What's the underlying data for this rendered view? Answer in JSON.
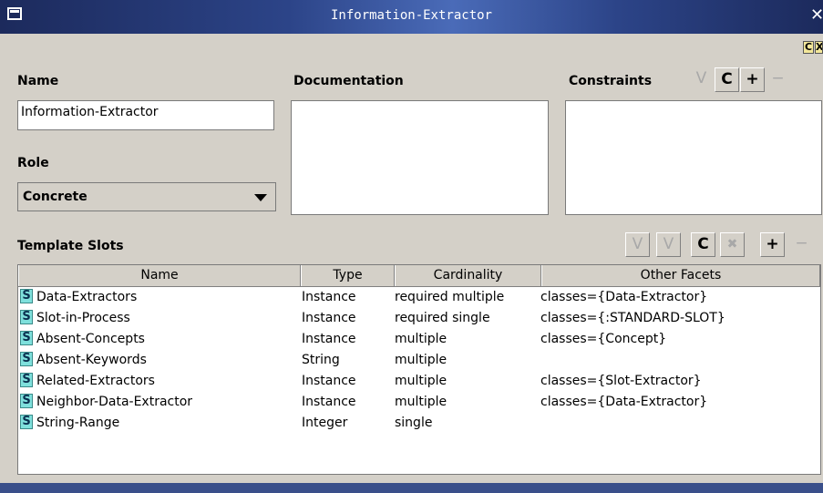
{
  "window": {
    "title": "Information-Extractor",
    "close_glyph": "✕"
  },
  "strip": {
    "c_label": "C",
    "x_label": "X"
  },
  "name_section": {
    "label": "Name",
    "value": "Information-Extractor"
  },
  "role_section": {
    "label": "Role",
    "value": "Concrete"
  },
  "documentation": {
    "label": "Documentation"
  },
  "constraints": {
    "label": "Constraints",
    "v_label": "V",
    "c_label": "C",
    "add_label": "+",
    "remove_label": "−"
  },
  "template_slots": {
    "label": "Template Slots",
    "buttons": {
      "v1": "V",
      "v2": "V",
      "c": "C",
      "x": "✖",
      "add": "+",
      "remove": "−"
    },
    "columns": [
      "Name",
      "Type",
      "Cardinality",
      "Other Facets"
    ],
    "rows": [
      {
        "icon": "S",
        "name": "Data-Extractors",
        "type": "Instance",
        "cardinality": "required multiple",
        "facets": "classes={Data-Extractor}"
      },
      {
        "icon": "S",
        "name": "Slot-in-Process",
        "type": "Instance",
        "cardinality": "required single",
        "facets": "classes={:STANDARD-SLOT}"
      },
      {
        "icon": "S",
        "name": "Absent-Concepts",
        "type": "Instance",
        "cardinality": "multiple",
        "facets": "classes={Concept}"
      },
      {
        "icon": "S",
        "name": "Absent-Keywords",
        "type": "String",
        "cardinality": "multiple",
        "facets": ""
      },
      {
        "icon": "S",
        "name": "Related-Extractors",
        "type": "Instance",
        "cardinality": "multiple",
        "facets": "classes={Slot-Extractor}"
      },
      {
        "icon": "S",
        "name": "Neighbor-Data-Extractor",
        "type": "Instance",
        "cardinality": "multiple",
        "facets": "classes={Data-Extractor}"
      },
      {
        "icon": "S",
        "name": "String-Range",
        "type": "Integer",
        "cardinality": "single",
        "facets": ""
      }
    ]
  },
  "colors": {
    "titlebar": "#2c4488",
    "window_bg": "#d4d0c8",
    "slot_icon": "#7fe0dc"
  }
}
